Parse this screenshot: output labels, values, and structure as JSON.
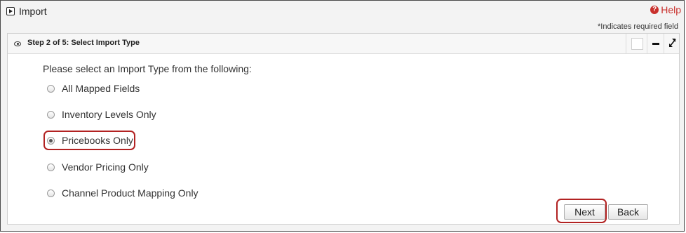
{
  "header": {
    "title": "Import",
    "help_label": "Help",
    "help_icon": "question-circle-icon",
    "required_note": "*Indicates required field"
  },
  "panel": {
    "step_title": "Step 2 of 5: Select Import Type",
    "header_icon": "eye-icon",
    "controls": [
      "blank-toggle",
      "minimize-icon",
      "expand-icon"
    ]
  },
  "form": {
    "prompt": "Please select an Import Type from the following:",
    "options": [
      {
        "label": "All Mapped Fields",
        "checked": false
      },
      {
        "label": "Inventory Levels Only",
        "checked": false
      },
      {
        "label": "Pricebooks Only",
        "checked": true
      },
      {
        "label": "Vendor Pricing Only",
        "checked": false
      },
      {
        "label": "Channel Product Mapping Only",
        "checked": false
      }
    ],
    "selected": "Pricebooks Only"
  },
  "buttons": {
    "next_label": "Next",
    "back_label": "Back"
  },
  "colors": {
    "annotation": "#b22222",
    "help": "#c9302c"
  }
}
